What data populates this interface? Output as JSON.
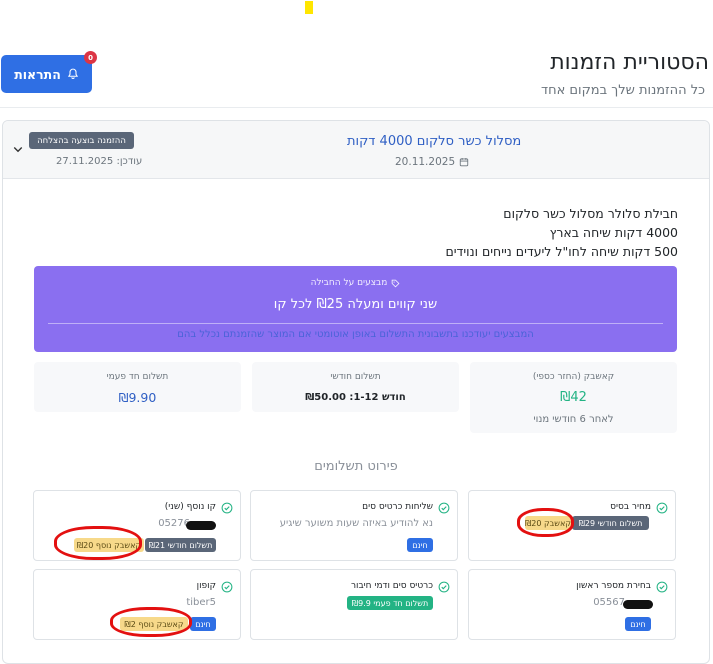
{
  "header": {
    "title": "הסטוריית הזמנות",
    "subtitle": "כל ההזמנות שלך במקום אחד",
    "alerts_label": "התראות",
    "alerts_count": "0"
  },
  "order": {
    "name": "מסלול כשר סלקום 4000 דקות",
    "date": "20.11.2025",
    "status": "ההזמנה בוצעה בהצלחה",
    "updated": "עודכן: 27.11.2025",
    "description": [
      "חבילת סלולר מסלול כשר סלקום",
      "4000 דקות שיחה בארץ",
      "500 דקות שיחה לחו\"ל ליעדים נייחים ונוידים"
    ],
    "promo": {
      "label": "מבצעים על החבילה",
      "main": "שני קווים ומעלה ₪25 לכל קו",
      "note": "המבצעים יעודכנו בתשבונית התשלום באופן אוטומטי אם המוצר שהזמנתם נכלל בהם"
    },
    "prices": {
      "one_time": {
        "label": "תשלום חד פעמי",
        "value": "₪9.90"
      },
      "monthly": {
        "label": "תשלום חודשי",
        "value": "חודש 1-12: ₪50.00"
      },
      "cashback": {
        "label": "קאשבק (החזר כספי)",
        "value": "₪42",
        "sub": "לאחר 6 חודשי מנוי"
      }
    },
    "payments_title": "פירוט תשלומים",
    "payments": {
      "base_price": {
        "title": "מחיר בסיס",
        "badge1": "תשלום חודשי ₪29",
        "badge2": "קאשבק ₪20"
      },
      "sim_shipping": {
        "title": "שליחות כרטיס סים",
        "sub": "נא להודיע באיזה שעות משוער שיגיע",
        "badge1": "חינם"
      },
      "extra_line": {
        "title": "קו נוסף (שני)",
        "sub": "05276",
        "badge1": "תשלום חודשי ₪21",
        "badge2": "קאשבק נוסף ₪20"
      },
      "number_choice": {
        "title": "בחירת מספר ראשון",
        "sub": "05567",
        "badge1": "חינם"
      },
      "sim_cards": {
        "title": "כרטיס סים ודמי חיבור",
        "badge1": "תשלום חד פעמי ₪9.9"
      },
      "coupon": {
        "title": "קופון",
        "sub": "tiber5",
        "badge1": "חינם",
        "badge2": "קאשבק נוסף ₪2"
      }
    }
  },
  "colors": {
    "primary": "#2f6fe4",
    "promo": "#8a6ff0",
    "success": "#23b384",
    "status": "#5a6678",
    "highlight": "#e31010"
  }
}
